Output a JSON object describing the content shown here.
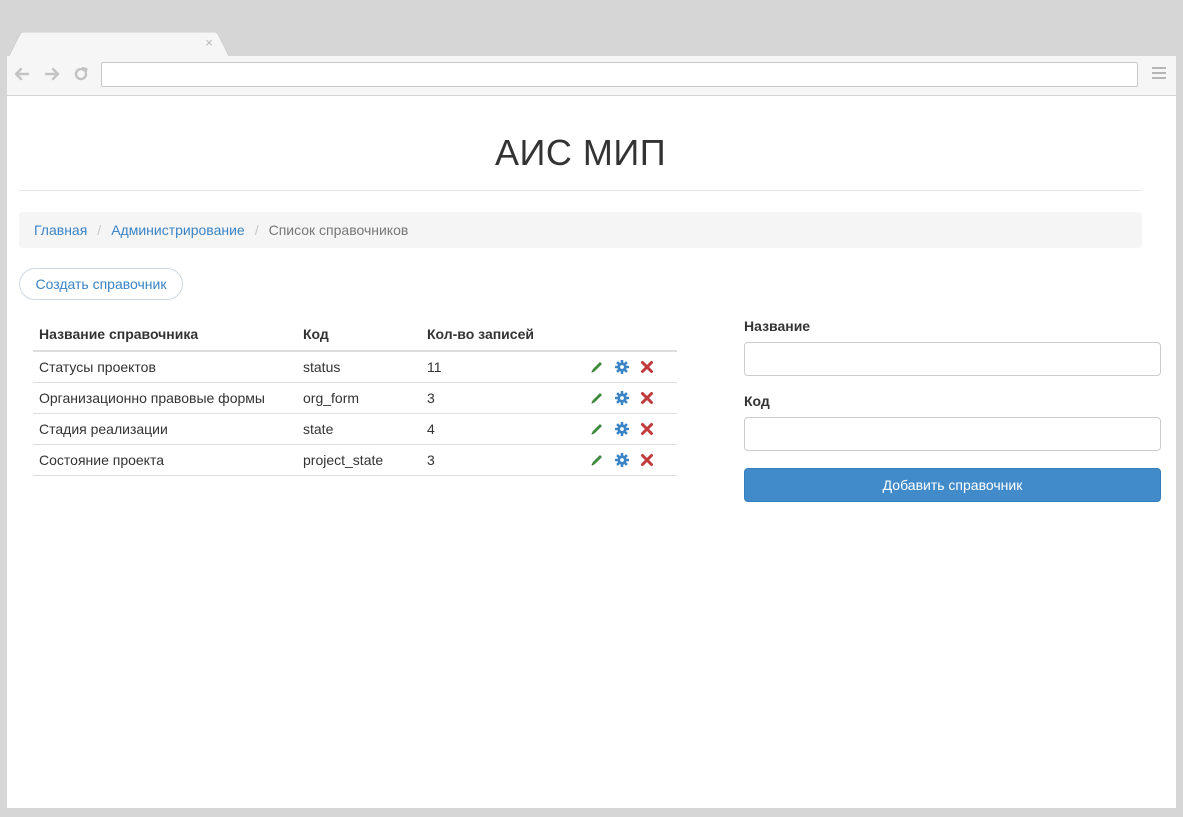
{
  "browser": {
    "tab_close": "×"
  },
  "site": {
    "title": "АИС МИП"
  },
  "breadcrumb": {
    "items": [
      {
        "label": "Главная"
      },
      {
        "label": "Администрирование"
      }
    ],
    "current": "Список справочников",
    "separator": "/"
  },
  "create_button": "Создать справочник",
  "table": {
    "headers": [
      "Название справочника",
      "Код",
      "Кол-во записей",
      ""
    ],
    "rows": [
      {
        "name": "Статусы проектов",
        "code": "status",
        "count": "11"
      },
      {
        "name": "Организационно правовые формы",
        "code": "org_form",
        "count": "3"
      },
      {
        "name": "Стадия реализации",
        "code": "state",
        "count": "4"
      },
      {
        "name": "Состояние проекта",
        "code": "project_state",
        "count": "3"
      }
    ],
    "row_actions": [
      "edit-icon",
      "settings-icon",
      "delete-icon"
    ],
    "action_colors": {
      "edit": "#3d8a3d",
      "settings": "#3a84c6",
      "delete": "#c0393b"
    }
  },
  "form": {
    "name_label": "Название",
    "name_value": "",
    "code_label": "Код",
    "code_value": "",
    "submit_label": "Добавить справочник"
  },
  "colors": {
    "link": "#3a84c6",
    "primary": "#428bca"
  }
}
